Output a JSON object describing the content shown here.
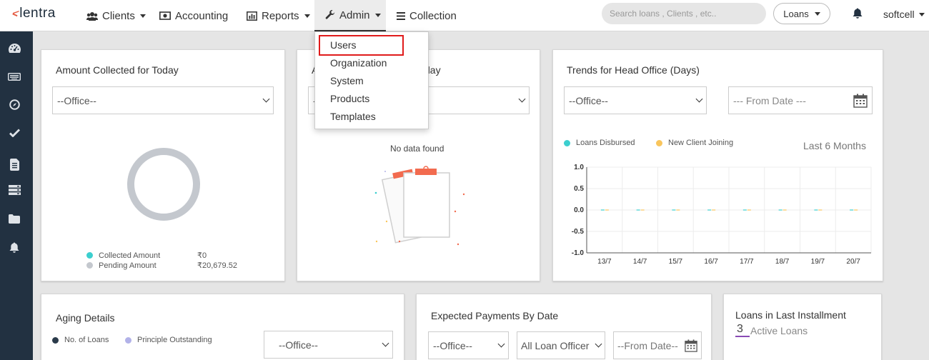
{
  "brand": {
    "name": "lentra"
  },
  "nav": {
    "clients": "Clients",
    "accounting": "Accounting",
    "reports": "Reports",
    "admin": "Admin",
    "collection": "Collection"
  },
  "search": {
    "placeholder": "Search loans , Clients , etc.."
  },
  "loans_button": "Loans",
  "user": {
    "name": "softcell"
  },
  "admin_menu": {
    "items": [
      "Users",
      "Organization",
      "System",
      "Products",
      "Templates"
    ],
    "highlighted": "Users"
  },
  "sidebar": {
    "icons": [
      "dashboard-icon",
      "keyboard-icon",
      "compass-icon",
      "check-icon",
      "document-icon",
      "server-icon",
      "folder-icon",
      "bell-icon"
    ]
  },
  "colors": {
    "sidebar": "#223141",
    "accent_red": "#e01b1b",
    "logo_accent": "#e4573d",
    "teal": "#3ccfcf",
    "yellow": "#f9c55c",
    "grey": "#c4c8ce",
    "lavender": "#b2b2e8",
    "navy": "#2a3a4a",
    "underline": "#8a4bb5"
  },
  "amount_collected": {
    "title": "Amount Collected for Today",
    "office_select": "--Office--",
    "legend": [
      {
        "label": "Collected Amount",
        "value": "₹0"
      },
      {
        "label": "Pending Amount",
        "value": "₹20,679.52"
      }
    ]
  },
  "amount_due": {
    "title_left": "A",
    "title_right": "day",
    "select_left": "-",
    "no_data": "No data found"
  },
  "trends": {
    "title": "Trends for Head Office (Days)",
    "office_select": "--Office--",
    "from_date_placeholder": "--- From Date ---",
    "legend": [
      "Loans Disbursed",
      "New Client Joining"
    ],
    "period": "Last 6 Months"
  },
  "chart_data": {
    "type": "line",
    "x": [
      "13/7",
      "14/7",
      "15/7",
      "16/7",
      "17/7",
      "18/7",
      "19/7",
      "20/7"
    ],
    "series": [
      {
        "name": "Loans Disbursed",
        "values": [
          0,
          0,
          0,
          0,
          0,
          0,
          0,
          0
        ]
      },
      {
        "name": "New Client Joining",
        "values": [
          0,
          0,
          0,
          0,
          0,
          0,
          0,
          0
        ]
      }
    ],
    "yticks": [
      "1.0",
      "0.5",
      "0.0",
      "-0.5",
      "-1.0"
    ],
    "ylim": [
      -1.0,
      1.0
    ],
    "grid": true,
    "legend_position": "top-left"
  },
  "aging": {
    "title": "Aging Details",
    "legend": [
      "No. of Loans",
      "Principle Outstanding"
    ],
    "office_select": "--Office--"
  },
  "expected_payments": {
    "title": "Expected Payments By Date",
    "office_select": "--Office--",
    "officer_select": "All Loan Officer",
    "from_date": "--From Date--"
  },
  "last_installment": {
    "title": "Loans in Last Installment",
    "count": "3",
    "label": "Active Loans"
  }
}
